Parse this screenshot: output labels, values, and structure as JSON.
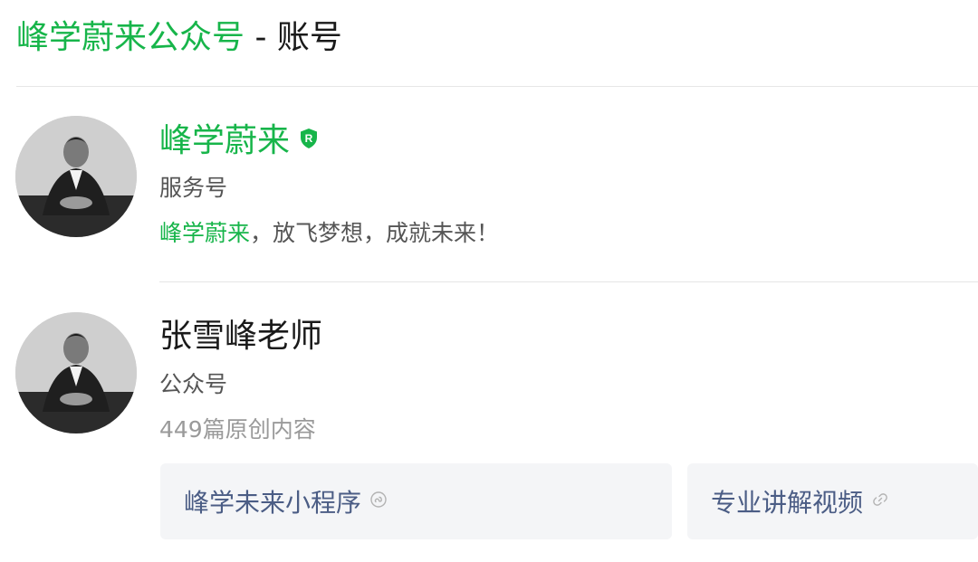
{
  "header": {
    "title_highlight": "峰学蔚来公众号",
    "title_rest": " - 账号"
  },
  "accounts": [
    {
      "name": "峰学蔚来",
      "type": "服务号",
      "verified_badge": "R",
      "verified_icon": "verified-shield-icon",
      "intro_highlight": "峰学蔚来",
      "intro_rest": "，放飞梦想，成就未来！"
    },
    {
      "name": "张雪峰老师",
      "type": "公众号",
      "article_count": "449篇原创内容",
      "links": [
        {
          "label": "峰学未来小程序",
          "icon": "mini-program-icon"
        },
        {
          "label": "专业讲解视频",
          "icon": "link-icon"
        }
      ]
    }
  ],
  "colors": {
    "brand_green": "#17b54a",
    "link_blue": "#4b5d85",
    "card_bg": "#f4f5f7"
  }
}
